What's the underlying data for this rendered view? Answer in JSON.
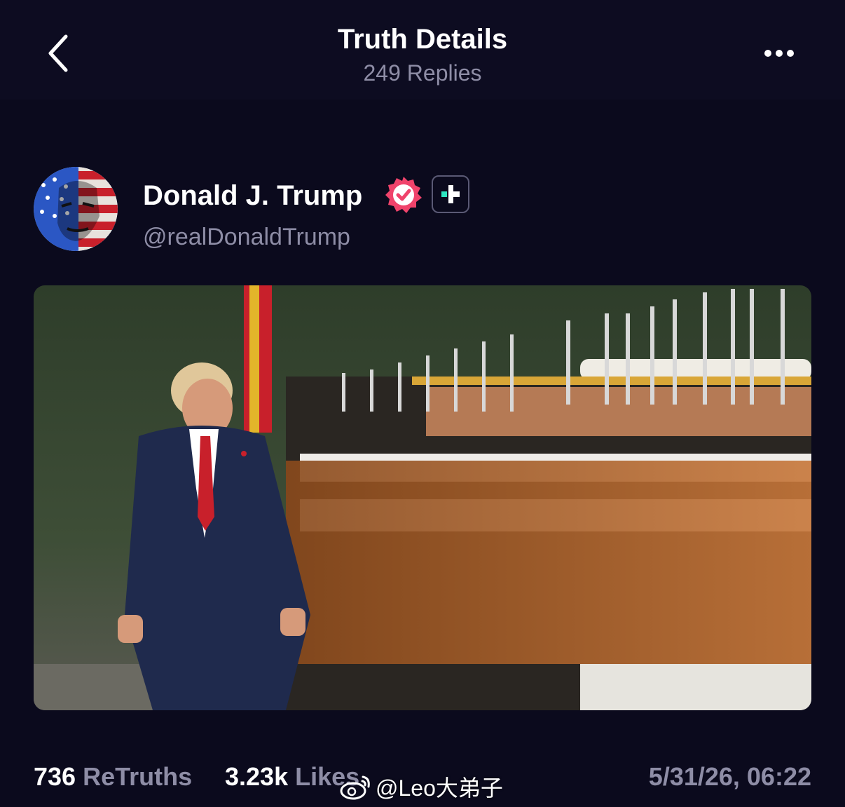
{
  "header": {
    "title": "Truth Details",
    "replies": "249 Replies",
    "back_icon": "chevron-left-icon",
    "more_icon": "more-horizontal-icon"
  },
  "author": {
    "display_name": "Donald J. Trump",
    "handle": "@realDonaldTrump",
    "verified_color": "#f0436b",
    "plus_badge_accent": "#2ee6c1"
  },
  "post": {
    "image_description_icon": "photo"
  },
  "stats": {
    "retruths_count": "736",
    "retruths_label": "ReTruths",
    "likes_count": "3.23k",
    "likes_label": "Likes",
    "timestamp": "5/31/26, 06:22"
  },
  "watermark": {
    "text": "@Leo大弟子"
  },
  "colors": {
    "background": "#0b0a1d",
    "muted_text": "#8e8da6",
    "primary_text": "#ffffff"
  }
}
